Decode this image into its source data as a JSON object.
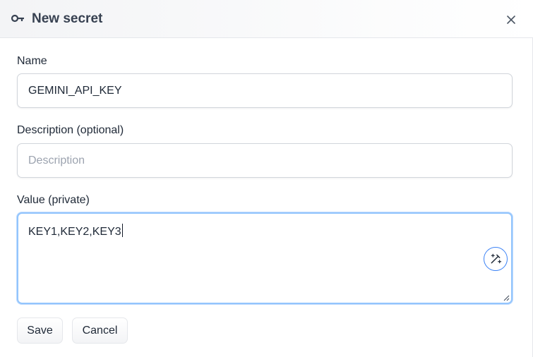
{
  "dialog": {
    "title": "New secret"
  },
  "form": {
    "name": {
      "label": "Name",
      "value": "GEMINI_API_KEY"
    },
    "description": {
      "label": "Description (optional)",
      "value": "",
      "placeholder": "Description"
    },
    "value": {
      "label": "Value (private)",
      "text": "KEY1,KEY2,KEY3"
    }
  },
  "actions": {
    "save_label": "Save",
    "cancel_label": "Cancel"
  },
  "colors": {
    "focus_border": "#93c5fd",
    "accent": "#3b82f6"
  }
}
